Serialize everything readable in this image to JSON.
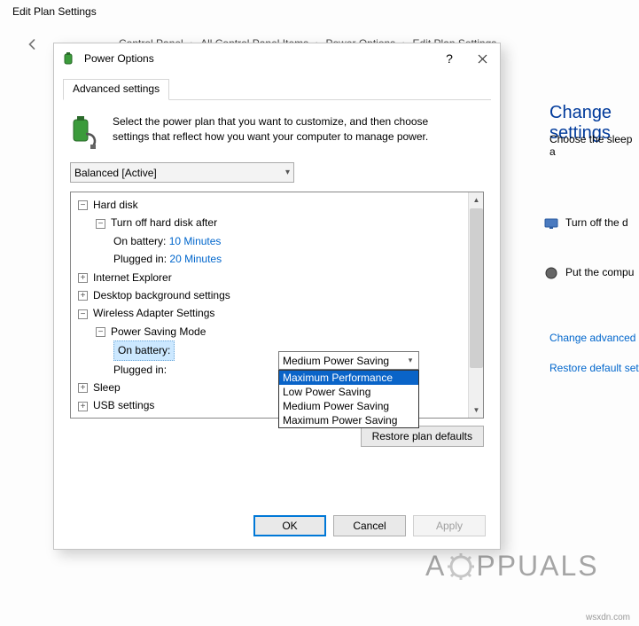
{
  "parent_window_title": "Edit Plan Settings",
  "breadcrumb": [
    "Control Panel",
    "All Control Panel Items",
    "Power Options",
    "Edit Plan Settings"
  ],
  "right": {
    "heading": "Change settings",
    "subtext": "Choose the sleep a",
    "row1": "Turn off the d",
    "row2": "Put the compu",
    "link1": "Change advanced",
    "link2": "Restore default set"
  },
  "dialog": {
    "title": "Power Options",
    "tab_label": "Advanced settings",
    "intro": "Select the power plan that you want to customize, and then choose settings that reflect how you want your computer to manage power.",
    "plan": "Balanced [Active]",
    "tree": {
      "hard_disk_label": "Hard disk",
      "turn_off_label": "Turn off hard disk after",
      "onb_label": "On battery:",
      "onb_val": "10 Minutes",
      "plug_label": "Plugged in:",
      "plug_val": "20 Minutes",
      "ie_label": "Internet Explorer",
      "desktop_label": "Desktop background settings",
      "wifi_label": "Wireless Adapter Settings",
      "psm_label": "Power Saving Mode",
      "psm_onb_label": "On battery:",
      "psm_onb_val": "Medium Power Saving",
      "psm_plug_label": "Plugged in:",
      "sleep_label": "Sleep",
      "usb_label": "USB settings"
    },
    "dropdown": {
      "options": [
        "Maximum Performance",
        "Low Power Saving",
        "Medium Power Saving",
        "Maximum Power Saving"
      ]
    },
    "restore_btn": "Restore plan defaults",
    "ok": "OK",
    "cancel": "Cancel",
    "apply": "Apply"
  },
  "watermark_text": "PPUALS",
  "wsx": "wsxdn.com"
}
